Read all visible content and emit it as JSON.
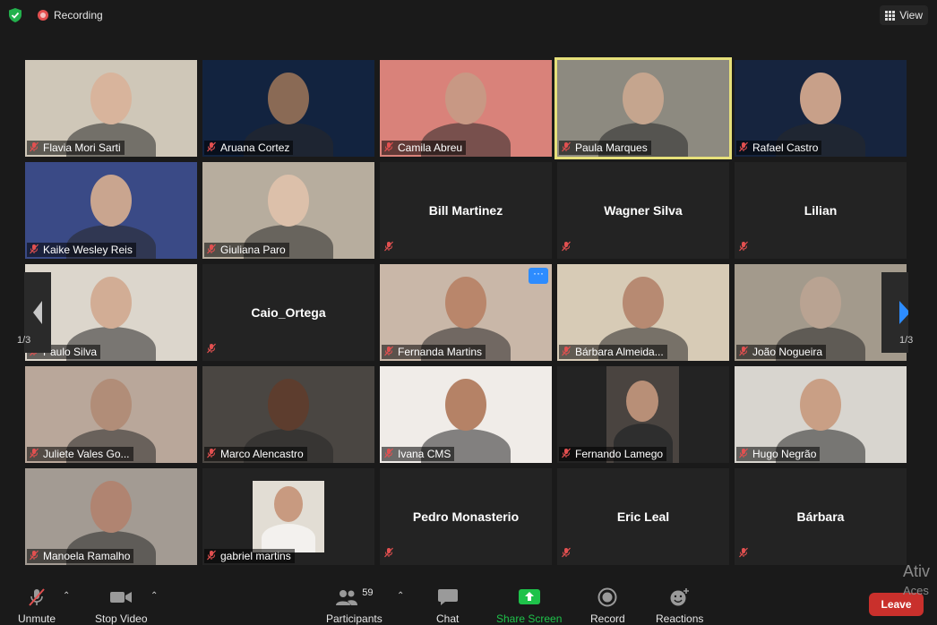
{
  "topbar": {
    "recording_label": "Recording",
    "view_label": "View"
  },
  "pager": {
    "left": "1/3",
    "right": "1/3"
  },
  "colors": {
    "active_speaker_border": "#e6e07a",
    "muted_icon": "#e25050",
    "share_screen": "#1ec24a",
    "leave": "#c9302c",
    "more_button": "#2d8cff"
  },
  "participants": [
    "Flavia Mori Sarti",
    "Aruana Cortez",
    "Camila Abreu",
    "Paula Marques",
    "Rafael Castro",
    "Kaike Wesley Reis",
    "Giuliana Paro",
    "Bill Martinez",
    "Wagner Silva",
    "Lilian",
    "Paulo Silva",
    "Caio_Ortega",
    "Fernanda Martins",
    "Bárbara Almeida...",
    "João Nogueira",
    "Juliete Vales Go...",
    "Marco Alencastro",
    "Ivana CMS",
    "Fernando Lamego",
    "Hugo Negrão",
    "Manoela Ramalho",
    "gabriel martins",
    "Pedro Monasterio",
    "Eric Leal",
    "Bárbara"
  ],
  "more_button": "···",
  "toolbar": {
    "unmute": "Unmute",
    "stop_video": "Stop Video",
    "participants": "Participants",
    "participant_count": "59",
    "chat": "Chat",
    "share_screen": "Share Screen",
    "record": "Record",
    "reactions": "Reactions",
    "leave": "Leave"
  },
  "watermark": {
    "line1": "Ativ",
    "line2": "Aces"
  }
}
